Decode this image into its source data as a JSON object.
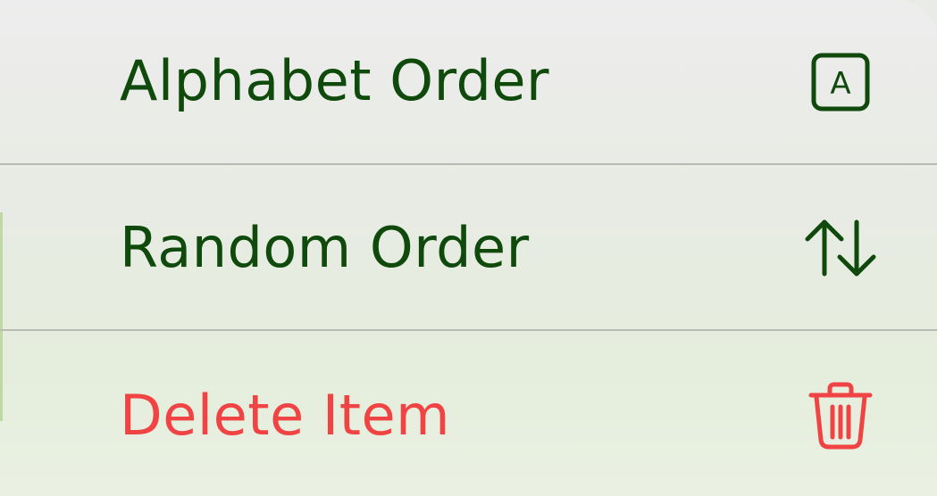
{
  "menu": {
    "items": [
      {
        "label": "Alphabet Order",
        "icon": "alphabet-a-square-icon",
        "color": "#0f4a0c",
        "destructive": false
      },
      {
        "label": "Random Order",
        "icon": "up-down-arrows-icon",
        "color": "#0f4a0c",
        "destructive": false
      },
      {
        "label": "Delete Item",
        "icon": "trash-icon",
        "color": "#f04444",
        "destructive": true
      }
    ],
    "icon_letter": "A"
  },
  "colors": {
    "primary_text": "#0f4a0c",
    "destructive_text": "#f04444",
    "divider": "#b7bbb4"
  }
}
